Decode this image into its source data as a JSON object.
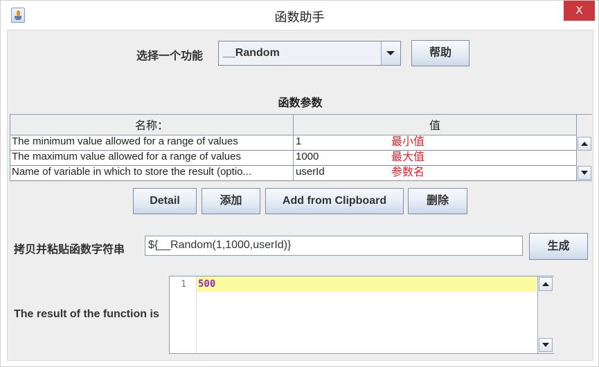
{
  "window": {
    "title": "函数助手",
    "close_label": "X",
    "app_icon": "java-cup-icon"
  },
  "function_select": {
    "label": "选择一个功能",
    "selected": "__Random",
    "help_button": "帮助"
  },
  "params": {
    "section_title": "函数参数",
    "columns": [
      "名称：",
      "值"
    ],
    "rows": [
      {
        "name": "The minimum value allowed for a range of values",
        "value": "1",
        "annotation": "最小值"
      },
      {
        "name": "The maximum value allowed for a range of values",
        "value": "1000",
        "annotation": "最大值"
      },
      {
        "name": "Name of variable in which to store the result (optio...",
        "value": "userId",
        "annotation": "参数名"
      }
    ],
    "annotation_color": "#e8202a"
  },
  "actions": {
    "detail": "Detail",
    "add": "添加",
    "add_from_clipboard": "Add from Clipboard",
    "delete": "删除"
  },
  "function_string": {
    "label": "拷贝并粘贴函数字符串",
    "value": "${__Random(1,1000,userId)}",
    "generate_button": "生成"
  },
  "result": {
    "label": "The result of the function is",
    "line_numbers": [
      "1"
    ],
    "lines": [
      "500"
    ],
    "highlight_color": "#fafaa0",
    "text_color": "#9c27b0"
  }
}
